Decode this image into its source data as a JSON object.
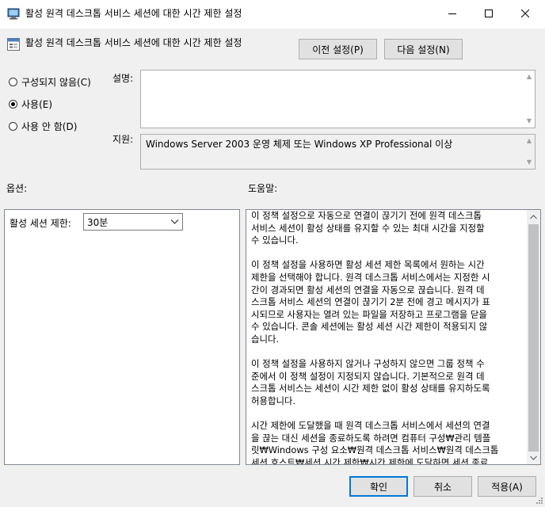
{
  "window": {
    "title": "활성 원격 데스크톱 서비스 세션에 대한 시간 제한 설정",
    "minimize_glyph": "minimize-icon",
    "maximize_glyph": "maximize-icon",
    "close_glyph": "close-icon"
  },
  "header": {
    "setting_name": "활성 원격 데스크톱 서비스 세션에 대한 시간 제한 설정",
    "prev_button": "이전 설정(P)",
    "next_button": "다음 설정(N)"
  },
  "state": {
    "options": [
      {
        "label": "구성되지 않음(C)",
        "checked": false
      },
      {
        "label": "사용(E)",
        "checked": true
      },
      {
        "label": "사용 안 함(D)",
        "checked": false
      }
    ]
  },
  "comment": {
    "label": "설명:",
    "value": ""
  },
  "supported": {
    "label": "지원:",
    "value": "Windows Server 2003 운영 체제 또는 Windows XP Professional 이상"
  },
  "options_section": {
    "label": "옵션:",
    "session_limit_label": "활성 세션 제한:",
    "session_limit_value": "30분"
  },
  "help_section": {
    "label": "도움말:",
    "text": "이 정책 설정으로 자동으로 연결이 끊기기 전에 원격 데스크톱\n서비스 세션이 활성 상태를 유지할 수 있는 최대 시간을 지정할\n수 있습니다.\n\n이 정책 설정을 사용하면 활성 세션 제한 목록에서 원하는 시간\n제한을 선택해야 합니다. 원격 데스크톱 서비스에서는 지정한 시\n간이 경과되면 활성 세션의 연결을 자동으로 끊습니다. 원격 데\n스크톱 서비스 세션의 연결이 끊기기 2분 전에 경고 메시지가 표\n시되므로 사용자는 열려 있는 파일을 저장하고 프로그램을 닫을\n수 있습니다. 콘솔 세션에는 활성 세션 시간 제한이 적용되지 않\n습니다.\n\n이 정책 설정을 사용하지 않거나 구성하지 않으면 그룹 정책 수\n준에서 이 정책 설정이 지정되지 않습니다. 기본적으로 원격 데\n스크톱 서비스는 세션이 시간 제한 없이 활성 상태를 유지하도록\n허용합니다.\n\n시간 제한에 도달했을 때 원격 데스크톱 서비스에서 세션의 연결\n을 끊는 대신 세션을 종료하도록 하려면 컴퓨터 구성₩관리 템플\n릿₩Windows 구성 요소₩원격 데스크톱 서비스₩원격 데스크톱\n세션 호스트₩세션 시간 제한₩시간 제한에 도달하면 세션 종료\n정책 설정을 구성할 수 있습니다."
  },
  "footer": {
    "ok": "확인",
    "cancel": "취소",
    "apply": "적용(A)"
  }
}
